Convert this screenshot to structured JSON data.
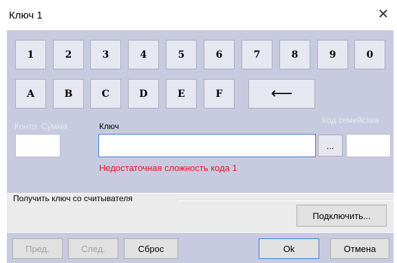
{
  "window": {
    "title": "Ключ 1",
    "close_glyph": "✕"
  },
  "keypad": {
    "row1": [
      "1",
      "2",
      "3",
      "4",
      "5",
      "6",
      "7",
      "8",
      "9",
      "0"
    ],
    "row2": [
      "A",
      "B",
      "C",
      "D",
      "E",
      "F"
    ],
    "backspace_glyph": "⟵"
  },
  "fields": {
    "checksum_label": "Контр. Сумма",
    "key_label": "Ключ",
    "key_value": "",
    "browse_label": "...",
    "family_label": "Код семейства"
  },
  "error_text": "Недостаточная сложность кода 1",
  "reader_group": {
    "title": "Получить ключ со считывателя",
    "connect_label": "Подключить..."
  },
  "footer": {
    "prev_label": "Пред.",
    "next_label": "След.",
    "reset_label": "Сброс",
    "ok_label": "Ok",
    "cancel_label": "Отмена"
  }
}
